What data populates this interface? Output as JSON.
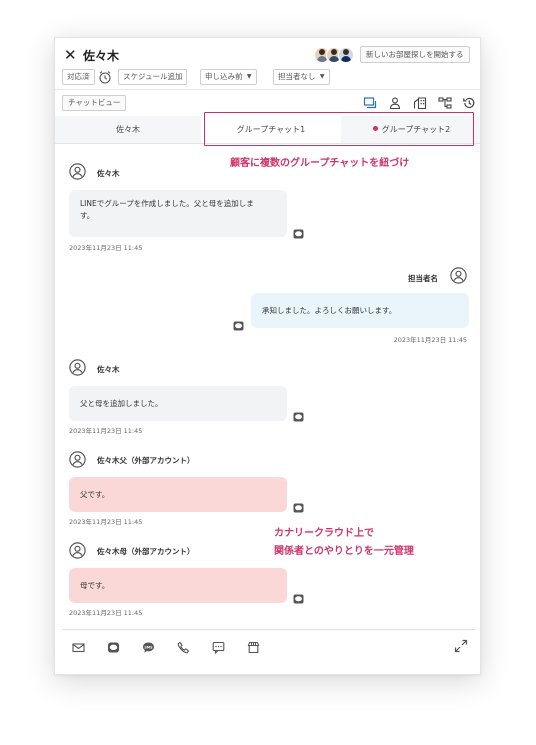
{
  "header": {
    "title": "佐々木",
    "start_button": "新しいお部屋探しを開始する"
  },
  "toolbar": {
    "status": "対応済",
    "schedule": "スケジュール追加",
    "application": "申し込み前",
    "assignee": "担当者なし"
  },
  "chatview_button": "チャットビュー",
  "tabs": [
    {
      "label": "佐々木"
    },
    {
      "label": "グループチャット1"
    },
    {
      "label": "グループチャット2",
      "unread": true
    }
  ],
  "annotations": {
    "top": "顧客に複数のグループチャットを紐づけ",
    "middle_line1": "カナリークラウド上で",
    "middle_line2": "関係者とのやりとりを一元管理"
  },
  "messages": [
    {
      "sender": "佐々木",
      "text": "LINEでグループを作成しました。父と母を追加しま\nす。",
      "time": "2023年11月23日 11:45"
    },
    {
      "sender": "担当者名",
      "text": "承知しました。よろしくお願いします。",
      "time": "2023年11月23日 11:45"
    },
    {
      "sender": "佐々木",
      "text": "父と母を追加しました。",
      "time": "2023年11月23日 11:45"
    },
    {
      "sender": "佐々木父（外部アカウント）",
      "text": "父です。",
      "time": "2023年11月23日 11:45"
    },
    {
      "sender": "佐々木母（外部アカウント）",
      "text": "母です。",
      "time": "2023年11月23日 11:45"
    }
  ],
  "bottom_icons": [
    "mail-icon",
    "line-icon",
    "sms-icon",
    "phone-icon",
    "chat-icon",
    "store-icon",
    "expand-icon"
  ],
  "colors": {
    "accent": "#d0346b",
    "pink_bubble": "#fbd8d8",
    "blue_bubble": "#eaf5fb",
    "grey_bubble": "#f1f3f5"
  }
}
